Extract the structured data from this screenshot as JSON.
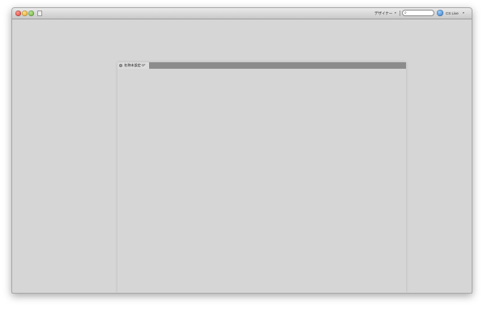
{
  "app": {
    "document_icon": "document-icon"
  },
  "toolbar": {
    "workspace_label": "デザイナー",
    "search_placeholder": "",
    "search_icon": "search-icon",
    "cs_live_icon": "cs-live-icon",
    "cs_live_label": "CS Live",
    "caret": "▾"
  },
  "document": {
    "tab_title": "名称未設定-1*",
    "tab_close": "×"
  }
}
